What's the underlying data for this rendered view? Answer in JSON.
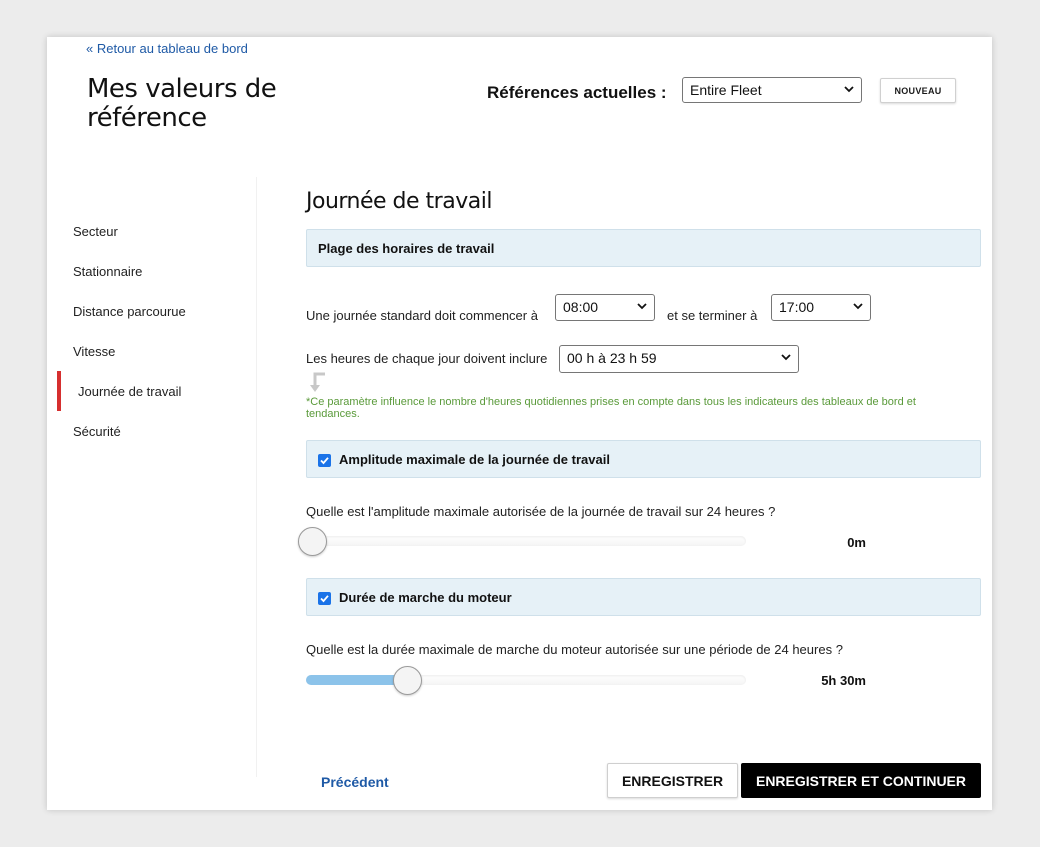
{
  "header": {
    "back_link": "« Retour au tableau de bord",
    "page_title": "Mes valeurs de référence",
    "references_label": "Références actuelles :",
    "references_value": "Entire Fleet",
    "new_button": "NOUVEAU"
  },
  "sidebar": {
    "items": [
      {
        "label": "Secteur",
        "active": false
      },
      {
        "label": "Stationnaire",
        "active": false
      },
      {
        "label": "Distance parcourue",
        "active": false
      },
      {
        "label": "Vitesse",
        "active": false
      },
      {
        "label": "Journée de travail",
        "active": true
      },
      {
        "label": "Sécurité",
        "active": false
      }
    ],
    "active_color": "#d62f2f"
  },
  "main": {
    "section_title": "Journée de travail",
    "work_hours": {
      "panel_title": "Plage des horaires de travail",
      "start_label": "Une journée standard doit commencer à",
      "start_value": "08:00",
      "end_label": "et se terminer à",
      "end_value": "17:00",
      "include_label": "Les heures de chaque jour doivent inclure",
      "include_value": "00 h à 23 h 59",
      "note": "*Ce paramètre influence le nombre d'heures quotidiennes prises en compte dans tous les indicateurs des tableaux de bord et tendances.",
      "note_color": "#5a9a3a"
    },
    "max_amplitude": {
      "panel_title": "Amplitude maximale de la journée de travail",
      "checked": true,
      "question": "Quelle est l'amplitude maximale autorisée de la journée de travail sur 24 heures ?",
      "value_label": "0m",
      "slider_fraction": 0.0
    },
    "engine_run": {
      "panel_title": "Durée de marche du moteur",
      "checked": true,
      "question": "Quelle est la durée maximale de marche du moteur autorisée sur une période de 24 heures ?",
      "value_label": "5h 30m",
      "slider_fraction": 0.23
    }
  },
  "footer": {
    "previous": "Précédent",
    "save": "ENREGISTRER",
    "save_continue": "ENREGISTRER ET CONTINUER"
  },
  "colors": {
    "panel_bg": "#e6f1f7",
    "link": "#1f5aa6",
    "slider_fill": "#8cc3ea",
    "checkbox": "#1a73e8"
  }
}
